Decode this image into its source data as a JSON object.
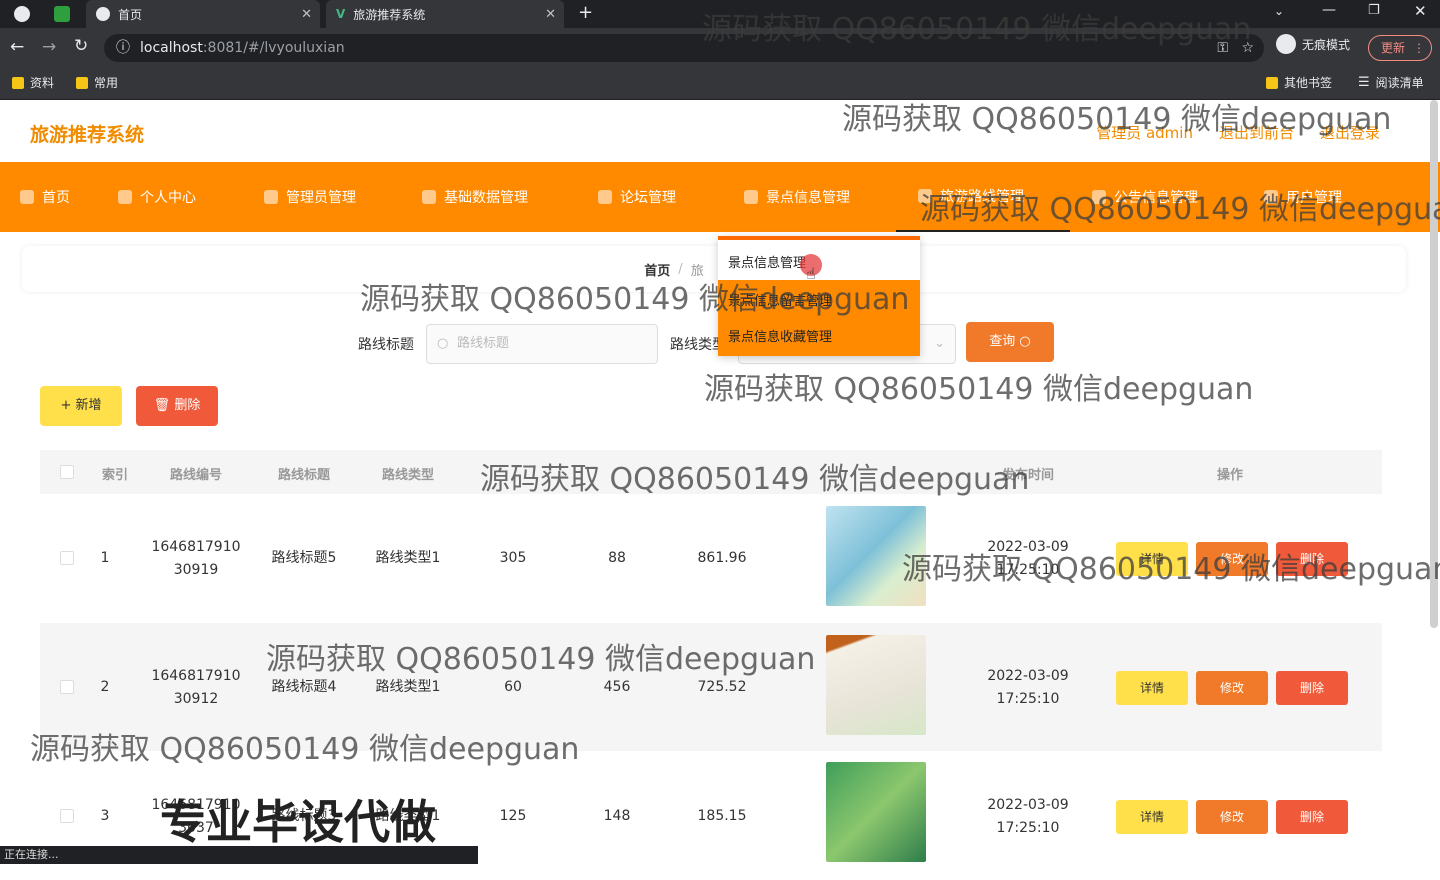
{
  "browser": {
    "tabs": [
      {
        "label": "首页"
      },
      {
        "label": "旅游推荐系统"
      }
    ],
    "url_host": "localhost",
    "url_rest": ":8081/#/lvyouluxian",
    "incognito_label": "无痕模式",
    "update_label": "更新",
    "bookmarks": [
      "资料",
      "常用"
    ],
    "bookmarks_right": [
      "其他书签",
      "阅读清单"
    ],
    "status": "正在连接..."
  },
  "app": {
    "title": "旅游推荐系统",
    "header_links": [
      "管理员 admin",
      "退出到前台",
      "退出登录"
    ],
    "nav": [
      "首页",
      "个人中心",
      "管理员管理",
      "基础数据管理",
      "论坛管理",
      "景点信息管理",
      "旅游路线管理",
      "公告信息管理",
      "用户管理"
    ],
    "breadcrumb": {
      "home": "首页",
      "sep": "/",
      "current": "旅"
    },
    "dropdown": [
      "景点信息管理",
      "景点信息留言管理",
      "景点信息收藏管理"
    ]
  },
  "search": {
    "label1": "路线标题",
    "placeholder1": "路线标题",
    "label2": "路线类型",
    "query_label": "查询"
  },
  "toolbar": {
    "add_label": "+ 新增",
    "delete_label": "删除"
  },
  "table": {
    "headers": [
      "索引",
      "路线编号",
      "路线标题",
      "路线类型",
      "",
      "",
      "",
      "",
      "发布时间",
      "操作"
    ],
    "rows": [
      {
        "index": "1",
        "code1": "1646817910",
        "code2": "30919",
        "title": "路线标题5",
        "type": "路线类型1",
        "n1": "305",
        "n2": "88",
        "n3": "861.96",
        "date": "2022-03-09",
        "time": "17:25:10"
      },
      {
        "index": "2",
        "code1": "1646817910",
        "code2": "30912",
        "title": "路线标题4",
        "type": "路线类型1",
        "n1": "60",
        "n2": "456",
        "n3": "725.52",
        "date": "2022-03-09",
        "time": "17:25:10"
      },
      {
        "index": "3",
        "code1": "1646817910",
        "code2": "3037",
        "title": "路线标题3",
        "type": "路线类型1",
        "n1": "125",
        "n2": "148",
        "n3": "185.15",
        "date": "2022-03-09",
        "time": "17:25:10"
      }
    ],
    "actions": {
      "detail": "详情",
      "edit": "修改",
      "delete": "删除"
    }
  },
  "watermarks": {
    "text": "源码获取 QQ86050149 微信deepguan",
    "big": "专业毕设代做"
  },
  "colors": {
    "accent": "#ff8a00",
    "logo": "#f08c00",
    "danger": "#f05a3a",
    "warn": "#ffe04b"
  }
}
